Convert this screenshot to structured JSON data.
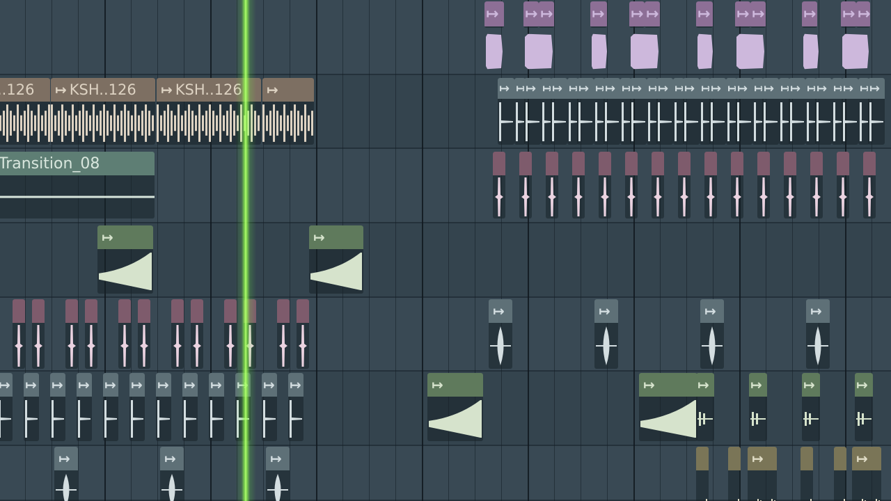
{
  "colors": {
    "purple_header": "#8d6f96",
    "purple_wave": "#cdb8dc",
    "tan_header": "#7d6f62",
    "tan_wave": "#ddd2c2",
    "slate_header": "#5e7077",
    "slate_wave": "#d3dde0",
    "teal_header": "#5e7e74",
    "teal_wave": "#d8e6dd",
    "mauve_header": "#7e5b6c",
    "mauve_wave": "#ead2e0",
    "green_header": "#5f7a5c",
    "green_wave": "#d6e3cc",
    "olive_header": "#7a7557",
    "olive_wave": "#e0dcc6",
    "playhead": "#7dff3c"
  },
  "icons": {
    "clip_icon": "clip-sample-icon",
    "clip_icon_glyph": "↦"
  },
  "clip_labels": {
    "ksh_partial": "..126",
    "ksh_a": "KSH..126",
    "ksh_b": "KSH..126",
    "transition": "Transition_08"
  }
}
